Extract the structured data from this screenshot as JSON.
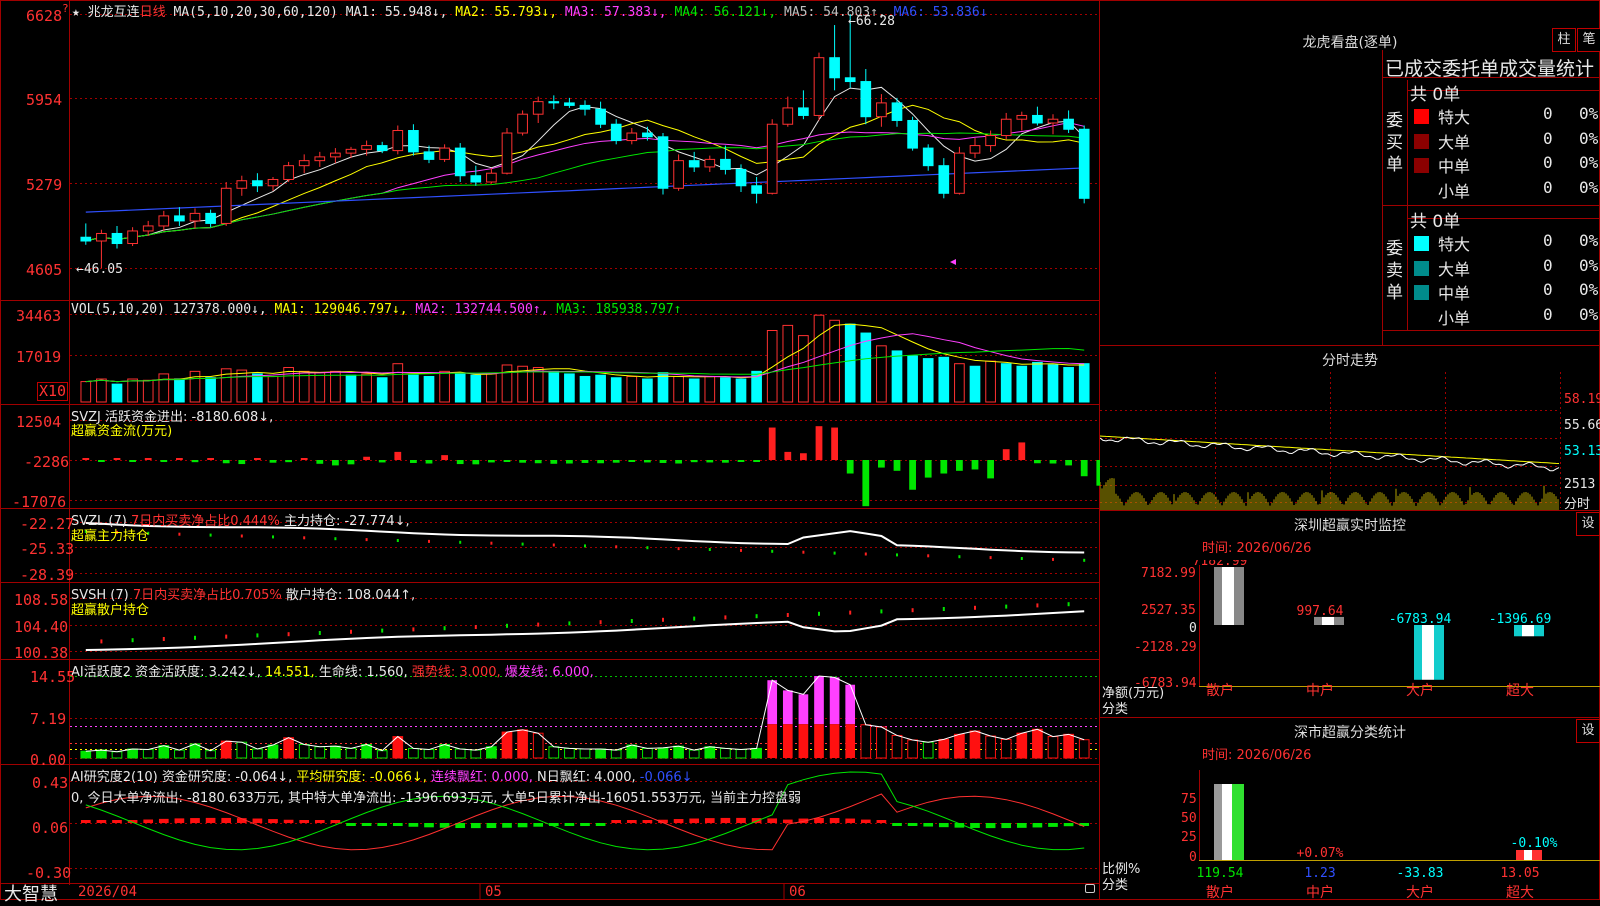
{
  "header": {
    "star": "★",
    "stock_name": "兆龙互连",
    "period": "日线",
    "ma_label": "MA(5,10,20,30,60,120)",
    "ma_values": [
      {
        "label": "MA1: 55.948↓,",
        "color": "#e8e8e8"
      },
      {
        "label": "MA2: 55.793↓,",
        "color": "#ffff00"
      },
      {
        "label": "MA3: 57.383↓,",
        "color": "#ff40ff"
      },
      {
        "label": "MA4: 56.121↓,",
        "color": "#00e600"
      },
      {
        "label": "MA5: 54.803↑,",
        "color": "#c0c0c0"
      },
      {
        "label": "MA6: 53.836↓",
        "color": "#3050ff"
      }
    ]
  },
  "price_axis": [
    "6628",
    "5954",
    "5279",
    "4605"
  ],
  "price_annotations": {
    "high": "66.28",
    "low": "46.05"
  },
  "vol_panel": {
    "title": "VOL(5,10,20)",
    "value": "127378.000↓,",
    "ma1": "MA1: 129046.797↓,",
    "ma2": "MA2: 132744.500↑,",
    "ma3": "MA3: 185938.797↑",
    "axis": [
      "34463",
      "17019"
    ],
    "unit": "X10"
  },
  "svzj_panel": {
    "line1": "SVZJ  活跃资金进出: -8180.608↓,",
    "line2": "超赢资金流(万元)",
    "axis": [
      "12504",
      "-2286",
      "-17076"
    ]
  },
  "svzl_panel": {
    "prefix": "SVZL (7)",
    "pct": "7日内买卖净占比0.444%",
    "rest": "主力持仓: -27.774↓,",
    "line2": "超赢主力持仓",
    "axis": [
      "-22.27",
      "-25.33",
      "-28.39"
    ]
  },
  "svsh_panel": {
    "prefix": "SVSH (7)",
    "pct": "7日内买卖净占比0.705%",
    "rest": "散户持仓: 108.044↑,",
    "line2": "超赢散户持仓",
    "axis": [
      "108.58",
      "104.40",
      "100.38"
    ]
  },
  "ai_active_panel": {
    "a": "AI活跃度2",
    "b": "资金活跃度: 3.242↓,",
    "c": "14.551,",
    "d": "生命线: 1.560,",
    "e": "强势线: 3.000,",
    "f": "爆发线: 6.000,",
    "axis": [
      "14.55",
      "7.19",
      "0.00"
    ]
  },
  "ai_research_panel": {
    "a": "AI研究度2(10)",
    "b": "资金研究度: -0.064↓,",
    "c": "平均研究度: -0.066↓,",
    "d": "连续飘红: 0.000,",
    "e": "N日飘红: 4.000,",
    "f": "-0.066↓",
    "desc": "0, 今日大单净流出: -8180.633万元, 其中特大单净流出: -1396.693万元, 大单5日累计净出-16051.553万元, 当前主力控盘弱",
    "axis": [
      "0.43",
      "0.06",
      "-0.30"
    ]
  },
  "bottom": {
    "brand": "大智慧",
    "dates": [
      "2026/04",
      "05",
      "06"
    ]
  },
  "right": {
    "lhb_title": "龙虎看盘(逐单)",
    "btn_zhu": "柱",
    "btn_bi": "笔",
    "section_title": "已成交委托单成交量统计",
    "buy_label": "委买单",
    "sell_label": "委卖单",
    "buy_total": "共 0单",
    "sell_total": "共 0单",
    "buy_rows": [
      {
        "name": "特大",
        "num": "0",
        "pct": "0%",
        "color": "#ff0000"
      },
      {
        "name": "大单",
        "num": "0",
        "pct": "0%",
        "color": "#8b0000"
      },
      {
        "name": "中单",
        "num": "0",
        "pct": "0%",
        "color": "#8b0000"
      },
      {
        "name": "小单",
        "num": "0",
        "pct": "0%",
        "color": ""
      }
    ],
    "sell_rows": [
      {
        "name": "特大",
        "num": "0",
        "pct": "0%",
        "color": "#00ffff"
      },
      {
        "name": "大单",
        "num": "0",
        "pct": "0%",
        "color": "#008b8b"
      },
      {
        "name": "中单",
        "num": "0",
        "pct": "0%",
        "color": "#008b8b"
      },
      {
        "name": "小单",
        "num": "0",
        "pct": "0%",
        "color": ""
      }
    ],
    "intraday_title": "分时走势",
    "intraday_axis": [
      "58.19",
      "55.66",
      "53.13",
      "2513"
    ],
    "intraday_label": "分时",
    "sz_monitor": {
      "title": "深圳超赢实时监控",
      "btn": "设",
      "time": "时间: 2026/06/26",
      "axis": [
        "7182.99",
        "2527.35",
        "0",
        "-2128.29",
        "-6783.94"
      ],
      "ylabel": "净额(万元)",
      "xlabel": "分类",
      "cats": [
        "散户",
        "中户",
        "大户",
        "超大"
      ],
      "values_text": [
        "7182.99",
        "997.64",
        "-6783.94",
        "-1396.69"
      ]
    },
    "sz_stat": {
      "title": "深市超赢分类统计",
      "btn": "设",
      "time": "时间: 2026/06/26",
      "axis": [
        "75",
        "50",
        "25",
        "0"
      ],
      "ylabel": "比例%",
      "xlabel": "分类",
      "cats": [
        "散户",
        "中户",
        "大户",
        "超大"
      ],
      "values_text": [
        "119.54",
        "1.23",
        "-33.83",
        "13.05"
      ],
      "pct_text": [
        "+0.07%",
        "-0.10%"
      ]
    }
  },
  "chart_data": {
    "type": "candlestick",
    "title": "兆龙互连 日线",
    "x": [
      "2026/04",
      "05",
      "06"
    ],
    "ohlc": [
      [
        48.5,
        49.6,
        47.9,
        48.2
      ],
      [
        48.2,
        49.1,
        46.05,
        48.8
      ],
      [
        48.8,
        49.4,
        47.6,
        48.0
      ],
      [
        48.0,
        49.3,
        47.8,
        49.0
      ],
      [
        49.0,
        49.8,
        48.6,
        49.4
      ],
      [
        49.4,
        50.6,
        49.0,
        50.2
      ],
      [
        50.2,
        50.9,
        49.4,
        49.8
      ],
      [
        49.8,
        50.8,
        49.2,
        50.4
      ],
      [
        50.4,
        50.7,
        49.3,
        49.6
      ],
      [
        49.6,
        52.9,
        49.4,
        52.4
      ],
      [
        52.4,
        53.4,
        51.8,
        53.0
      ],
      [
        53.0,
        53.6,
        52.1,
        52.6
      ],
      [
        52.6,
        53.3,
        52.2,
        53.1
      ],
      [
        53.1,
        54.5,
        52.9,
        54.2
      ],
      [
        54.2,
        55.1,
        53.6,
        54.6
      ],
      [
        54.6,
        55.3,
        54.1,
        54.9
      ],
      [
        54.9,
        55.6,
        54.4,
        55.2
      ],
      [
        55.2,
        55.7,
        54.8,
        55.5
      ],
      [
        55.5,
        56.2,
        55.0,
        55.8
      ],
      [
        55.8,
        56.1,
        55.2,
        55.4
      ],
      [
        55.4,
        57.4,
        55.1,
        57.0
      ],
      [
        57.0,
        57.5,
        55.0,
        55.3
      ],
      [
        55.3,
        55.8,
        54.4,
        54.7
      ],
      [
        54.7,
        55.9,
        54.5,
        55.6
      ],
      [
        55.6,
        56.0,
        52.9,
        53.4
      ],
      [
        53.4,
        54.2,
        52.6,
        52.9
      ],
      [
        52.9,
        54.0,
        52.8,
        53.6
      ],
      [
        53.6,
        57.2,
        53.5,
        56.8
      ],
      [
        56.8,
        58.6,
        56.6,
        58.3
      ],
      [
        58.3,
        59.7,
        57.6,
        59.3
      ],
      [
        59.3,
        59.8,
        58.7,
        59.2
      ],
      [
        59.2,
        59.6,
        58.8,
        59.0
      ],
      [
        59.0,
        59.4,
        58.2,
        58.7
      ],
      [
        58.7,
        59.3,
        57.2,
        57.5
      ],
      [
        57.5,
        57.9,
        55.9,
        56.2
      ],
      [
        56.2,
        57.2,
        55.9,
        56.8
      ],
      [
        56.8,
        57.3,
        56.2,
        56.5
      ],
      [
        56.5,
        56.8,
        51.9,
        52.4
      ],
      [
        52.4,
        55.1,
        52.2,
        54.6
      ],
      [
        54.6,
        55.3,
        53.7,
        54.1
      ],
      [
        54.1,
        55.0,
        53.7,
        54.7
      ],
      [
        54.7,
        55.8,
        53.5,
        53.9
      ],
      [
        53.9,
        54.3,
        52.1,
        52.6
      ],
      [
        52.6,
        53.3,
        51.2,
        52.0
      ],
      [
        52.0,
        57.9,
        51.9,
        57.5
      ],
      [
        57.5,
        59.7,
        57.3,
        58.8
      ],
      [
        58.8,
        60.2,
        57.9,
        58.2
      ],
      [
        58.2,
        63.2,
        57.8,
        62.8
      ],
      [
        62.8,
        65.4,
        60.2,
        61.2
      ],
      [
        61.2,
        66.28,
        60.4,
        60.9
      ],
      [
        60.9,
        61.9,
        57.5,
        58.1
      ],
      [
        58.1,
        59.9,
        57.3,
        59.2
      ],
      [
        59.2,
        59.6,
        57.3,
        57.8
      ],
      [
        57.8,
        58.1,
        55.4,
        55.6
      ],
      [
        55.6,
        55.9,
        53.8,
        54.2
      ],
      [
        54.2,
        54.8,
        51.6,
        52.0
      ],
      [
        52.0,
        55.7,
        51.9,
        55.2
      ],
      [
        55.2,
        56.4,
        54.8,
        55.8
      ],
      [
        55.8,
        57.0,
        55.3,
        56.6
      ],
      [
        56.6,
        58.4,
        56.3,
        57.9
      ],
      [
        57.9,
        58.5,
        57.0,
        58.2
      ],
      [
        58.2,
        58.9,
        57.4,
        57.6
      ],
      [
        57.6,
        58.3,
        56.7,
        57.9
      ],
      [
        57.9,
        58.6,
        56.8,
        57.1
      ],
      [
        57.1,
        57.4,
        51.2,
        51.6
      ]
    ],
    "volume": [
      [
        8000,
        1
      ],
      [
        9000,
        1
      ],
      [
        7000,
        0
      ],
      [
        9000,
        1
      ],
      [
        8500,
        1
      ],
      [
        11000,
        1
      ],
      [
        9000,
        0
      ],
      [
        12000,
        1
      ],
      [
        9500,
        0
      ],
      [
        13000,
        1
      ],
      [
        12500,
        1
      ],
      [
        11000,
        0
      ],
      [
        10000,
        1
      ],
      [
        13500,
        1
      ],
      [
        12000,
        1
      ],
      [
        11500,
        1
      ],
      [
        12000,
        1
      ],
      [
        10500,
        0
      ],
      [
        11000,
        1
      ],
      [
        9500,
        0
      ],
      [
        15000,
        1
      ],
      [
        10500,
        0
      ],
      [
        10000,
        0
      ],
      [
        12000,
        1
      ],
      [
        11000,
        0
      ],
      [
        10500,
        0
      ],
      [
        11000,
        1
      ],
      [
        14500,
        1
      ],
      [
        14000,
        1
      ],
      [
        13500,
        1
      ],
      [
        12000,
        0
      ],
      [
        11000,
        0
      ],
      [
        10000,
        0
      ],
      [
        10500,
        0
      ],
      [
        9500,
        0
      ],
      [
        10000,
        1
      ],
      [
        9000,
        0
      ],
      [
        11500,
        0
      ],
      [
        10000,
        1
      ],
      [
        9000,
        0
      ],
      [
        10000,
        1
      ],
      [
        9500,
        0
      ],
      [
        9000,
        0
      ],
      [
        12000,
        0
      ],
      [
        28000,
        1
      ],
      [
        30000,
        1
      ],
      [
        26000,
        1
      ],
      [
        34000,
        1
      ],
      [
        32000,
        1
      ],
      [
        30500,
        0
      ],
      [
        27000,
        0
      ],
      [
        22000,
        1
      ],
      [
        20000,
        0
      ],
      [
        18000,
        0
      ],
      [
        17000,
        0
      ],
      [
        17500,
        0
      ],
      [
        15000,
        1
      ],
      [
        14000,
        0
      ],
      [
        16000,
        1
      ],
      [
        15000,
        0
      ],
      [
        14000,
        0
      ],
      [
        15500,
        0
      ],
      [
        14500,
        0
      ],
      [
        13500,
        0
      ],
      [
        15000,
        0
      ]
    ],
    "svzj": [
      500,
      -300,
      400,
      -600,
      300,
      -500,
      700,
      -800,
      400,
      -1200,
      -1500,
      500,
      -1000,
      -800,
      600,
      -1400,
      -2000,
      -1600,
      1200,
      -900,
      3000,
      -1100,
      -1300,
      1800,
      -1500,
      -1600,
      -900,
      -700,
      -1000,
      -1200,
      -1400,
      -1300,
      -1100,
      -1200,
      -1000,
      -700,
      -900,
      -1100,
      -1300,
      -800,
      -900,
      -1000,
      -700,
      -600,
      12000,
      3000,
      2500,
      12504,
      12000,
      -5000,
      -17076,
      -2800,
      -4000,
      -11000,
      -6500,
      -5000,
      -4000,
      -3500,
      -6800,
      4000,
      6500,
      -1200,
      -1300,
      -2000,
      -6000,
      -9500
    ]
  }
}
